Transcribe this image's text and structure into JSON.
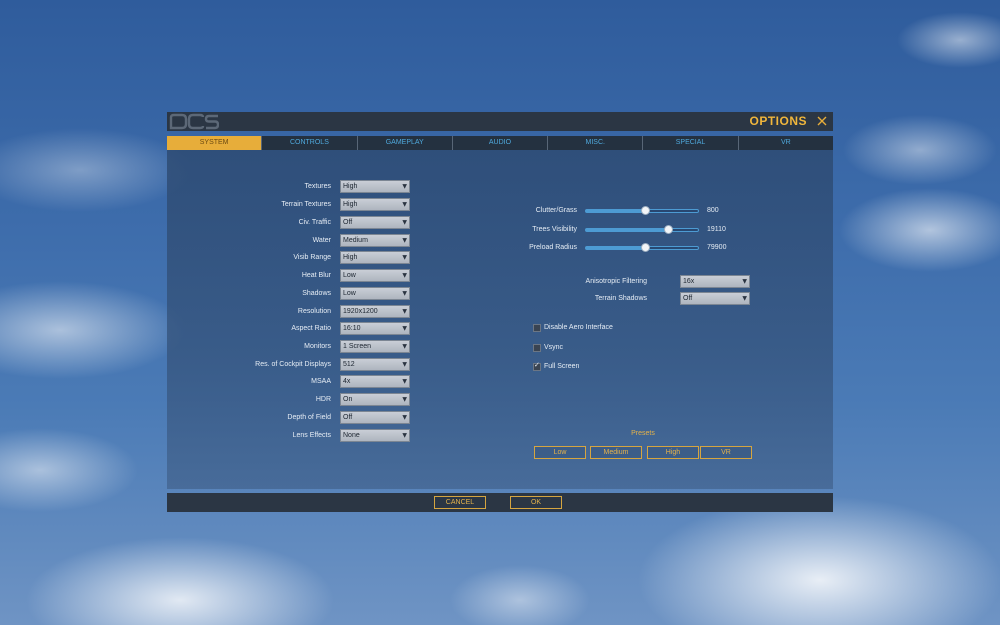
{
  "window": {
    "title": "OPTIONS",
    "logo_text": "DCS"
  },
  "colors": {
    "accent": "#e7ad3a",
    "tab_text": "#4fa9dd",
    "slider": "#4d9bd3"
  },
  "tabs": [
    {
      "label": "SYSTEM",
      "active": true
    },
    {
      "label": "CONTROLS"
    },
    {
      "label": "GAMEPLAY"
    },
    {
      "label": "AUDIO"
    },
    {
      "label": "MISC."
    },
    {
      "label": "SPECIAL"
    },
    {
      "label": "VR"
    }
  ],
  "settings": [
    {
      "label": "Textures",
      "value": "High"
    },
    {
      "label": "Terrain Textures",
      "value": "High"
    },
    {
      "label": "Civ. Traffic",
      "value": "Off"
    },
    {
      "label": "Water",
      "value": "Medium"
    },
    {
      "label": "Visib Range",
      "value": "High"
    },
    {
      "label": "Heat Blur",
      "value": "Low"
    },
    {
      "label": "Shadows",
      "value": "Low"
    },
    {
      "label": "Resolution",
      "value": "1920x1200"
    },
    {
      "label": "Aspect Ratio",
      "value": "16:10"
    },
    {
      "label": "Monitors",
      "value": "1 Screen"
    },
    {
      "label": "Res. of Cockpit Displays",
      "value": "512"
    },
    {
      "label": "MSAA",
      "value": "4x"
    },
    {
      "label": "HDR",
      "value": "On"
    },
    {
      "label": "Depth of Field",
      "value": "Off"
    },
    {
      "label": "Lens Effects",
      "value": "None"
    }
  ],
  "sliders": [
    {
      "label": "Clutter/Grass",
      "value": "800",
      "level": 0.53
    },
    {
      "label": "Trees Visibility",
      "value": "19110",
      "level": 0.73
    },
    {
      "label": "Preload Radius",
      "value": "79900",
      "level": 0.53
    }
  ],
  "right_selects": [
    {
      "label": "Anisotropic Filtering",
      "value": "16x"
    },
    {
      "label": "Terrain Shadows",
      "value": "Off"
    }
  ],
  "checkboxes": [
    {
      "label": "Disable Aero Interface",
      "checked": false
    },
    {
      "label": "Vsync",
      "checked": false
    },
    {
      "label": "Full Screen",
      "checked": true
    }
  ],
  "presets": {
    "title": "Presets",
    "buttons": [
      "Low",
      "Medium",
      "High",
      "VR"
    ]
  },
  "footer": {
    "cancel": "CANCEL",
    "ok": "OK"
  }
}
